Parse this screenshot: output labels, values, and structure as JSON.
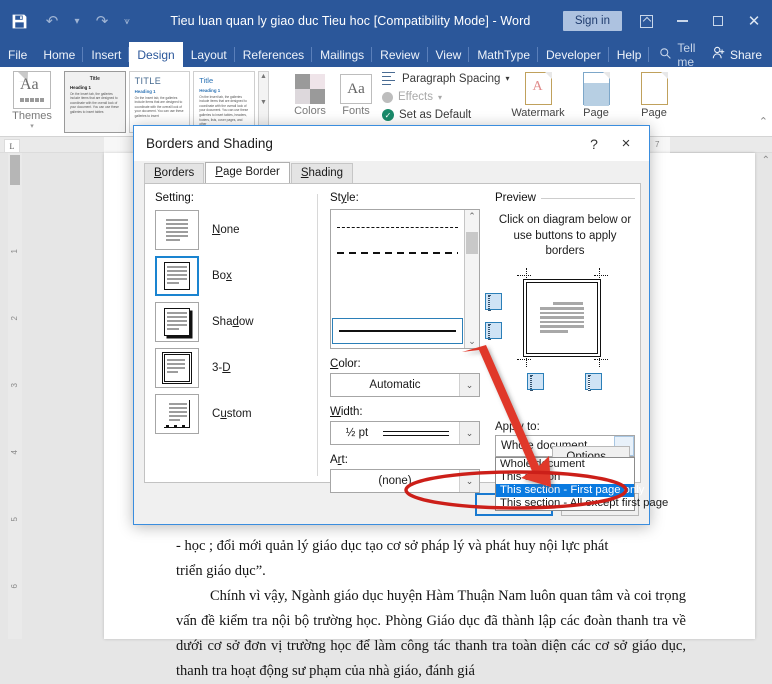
{
  "window": {
    "title": "Tieu luan quan ly giao duc Tieu hoc [Compatibility Mode]  -  Word",
    "sign_in": "Sign in",
    "quick_access": [
      "save-icon",
      "undo-icon",
      "redo-icon",
      "customize-icon"
    ],
    "controls": [
      "ribbon-display-options-icon",
      "minimize-icon",
      "restore-icon",
      "close-icon"
    ]
  },
  "ribbon_tabs": [
    {
      "label": "File",
      "active": false
    },
    {
      "label": "Home",
      "active": false
    },
    {
      "label": "Insert",
      "active": false
    },
    {
      "label": "Design",
      "active": true
    },
    {
      "label": "Layout",
      "active": false
    },
    {
      "label": "References",
      "active": false
    },
    {
      "label": "Mailings",
      "active": false
    },
    {
      "label": "Review",
      "active": false
    },
    {
      "label": "View",
      "active": false
    },
    {
      "label": "MathType",
      "active": false
    },
    {
      "label": "Developer",
      "active": false
    },
    {
      "label": "Help",
      "active": false
    }
  ],
  "ribbon_right": {
    "tell_me": "Tell me",
    "share": "Share"
  },
  "ribbon": {
    "themes_label": "Themes",
    "style_gallery": [
      {
        "title": "Title",
        "heading": "Heading 1",
        "body": "On the Insert tab, the galleries include items that are designed to coordinate with the overall look of your document. You can use these galleries to insert tables"
      },
      {
        "title": "TITLE",
        "heading": "Heading 1",
        "body": "On the Insert tab, the galleries include items that are designed to coordinate with the overall look of your document. You can use these galleries to insert"
      },
      {
        "title": "Title",
        "heading": "Heading 1",
        "body": "On the Insert tab, the galleries include items that are designed to coordinate with the overall look of your document. You can use these galleries to insert tables, headers, footers, lists, cover pages, and other"
      }
    ],
    "colors_label": "Colors",
    "fonts_label": "Fonts",
    "paragraph_spacing": "Paragraph Spacing",
    "effects": "Effects",
    "set_as_default": "Set as Default",
    "watermark": "Watermark",
    "page_color": "Page",
    "page_borders": "Page"
  },
  "rulers": {
    "horizontal_marks": [
      "7"
    ],
    "vertical_marks": [
      "1",
      "2",
      "3",
      "4",
      "5",
      "6"
    ],
    "tab_stop_icon": "left-tab-stop-icon"
  },
  "dialog": {
    "title": "Borders and Shading",
    "help_icon": "?",
    "close_icon": "×",
    "tabs": [
      {
        "label": "Borders",
        "accel": "B",
        "active": false
      },
      {
        "label": "Page Border",
        "accel": "P",
        "active": true
      },
      {
        "label": "Shading",
        "accel": "S",
        "active": false
      }
    ],
    "setting": {
      "label": "Setting:",
      "options": [
        {
          "label": "None",
          "selected": false
        },
        {
          "label": "Box",
          "selected": true
        },
        {
          "label": "Shadow",
          "selected": false
        },
        {
          "label": "3-D",
          "selected": false
        },
        {
          "label": "Custom",
          "selected": false
        }
      ]
    },
    "style": {
      "label": "Style:",
      "items": [
        "dashed-fine",
        "dashed",
        "dash-dot",
        "dash-dot-dot",
        "double-line"
      ],
      "selected_index": 4
    },
    "color": {
      "label": "Color:",
      "value": "Automatic"
    },
    "width": {
      "label": "Width:",
      "value": "½ pt"
    },
    "art": {
      "label": "Art:",
      "value": "(none)"
    },
    "preview": {
      "label": "Preview",
      "hint_line1": "Click on diagram below or",
      "hint_line2": "use buttons to apply borders"
    },
    "apply_to": {
      "label": "Apply to:",
      "value": "Whole document",
      "options": [
        {
          "label": "Whole document",
          "selected": false
        },
        {
          "label": "This section",
          "selected": false
        },
        {
          "label": "This section - First page only",
          "selected": true
        },
        {
          "label": "This section - All except first page",
          "selected": false
        }
      ]
    },
    "options_button": "Options...",
    "ok_button": "OK",
    "cancel_button": "Cancel"
  },
  "document": {
    "lines": [
      "- học ; đổi mới quản lý giáo dục tạo cơ sở pháp lý và phát huy nội lực phát",
      "triển giáo dục”.",
      "Chính vì vậy, Ngành giáo dục huyện Hàm Thuận Nam luôn quan tâm và coi trọng vấn đề kiểm tra nội bộ trường học. Phòng Giáo dục đã thành lập các đoàn thanh tra về dưới cơ sở đơn vị trường học để làm công tác thanh tra toàn diện các cơ sở giáo dục, thanh tra hoạt động sư phạm của nhà giáo, đánh giá"
    ]
  },
  "annotation": {
    "arrow": "red-arrow-pointing-to-apply-to-list",
    "ellipse": "red-ellipse-highlighting-selected-option",
    "color": "#e0392b"
  },
  "colors": {
    "word_blue": "#2b579a",
    "accent_blue": "#1a84d0",
    "selection_blue": "#0a7ae0",
    "annotation_red": "#e0392b"
  }
}
